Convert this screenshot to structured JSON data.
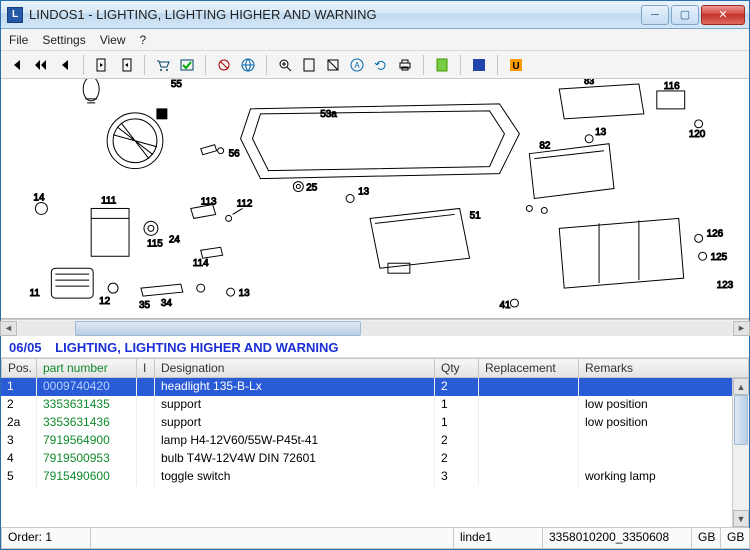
{
  "window": {
    "title": "LINDOS1 - LIGHTING, LIGHTING HIGHER AND WARNING"
  },
  "menubar": [
    "File",
    "Settings",
    "View",
    "?"
  ],
  "section": {
    "code": "06/05",
    "title": "LIGHTING, LIGHTING HIGHER AND WARNING"
  },
  "grid": {
    "headers": {
      "pos": "Pos.",
      "pn": "part number",
      "i": "I",
      "des": "Designation",
      "qty": "Qty",
      "rep": "Replacement",
      "rem": "Remarks"
    },
    "rows": [
      {
        "pos": "1",
        "pn": "0009740420",
        "i": "",
        "des": "headlight 135-B-Lx",
        "qty": "2",
        "rep": "",
        "rem": "",
        "selected": true
      },
      {
        "pos": "2",
        "pn": "3353631435",
        "i": "",
        "des": "support",
        "qty": "1",
        "rep": "",
        "rem": "low position"
      },
      {
        "pos": "2a",
        "pn": "3353631436",
        "i": "",
        "des": "support",
        "qty": "1",
        "rep": "",
        "rem": "low position"
      },
      {
        "pos": "3",
        "pn": "7919564900",
        "i": "",
        "des": "lamp H4-12V60/55W-P45t-41",
        "qty": "2",
        "rep": "",
        "rem": ""
      },
      {
        "pos": "4",
        "pn": "7919500953",
        "i": "",
        "des": "bulb T4W-12V4W  DIN 72601",
        "qty": "2",
        "rep": "",
        "rem": ""
      },
      {
        "pos": "5",
        "pn": "7915490600",
        "i": "",
        "des": "toggle switch",
        "qty": "3",
        "rep": "",
        "rem": "working lamp"
      }
    ]
  },
  "statusbar": {
    "order": "Order: 1",
    "model": "linde1",
    "code": "3358010200_3350608",
    "g1": "GB",
    "g2": "GB"
  },
  "diagram_labels": [
    "55",
    "53a",
    "56",
    "25",
    "51",
    "82",
    "13",
    "83",
    "116",
    "120",
    "13",
    "13",
    "14",
    "111",
    "113",
    "115",
    "24",
    "114",
    "112",
    "12",
    "11",
    "34",
    "35",
    "13",
    "126",
    "125",
    "123"
  ]
}
